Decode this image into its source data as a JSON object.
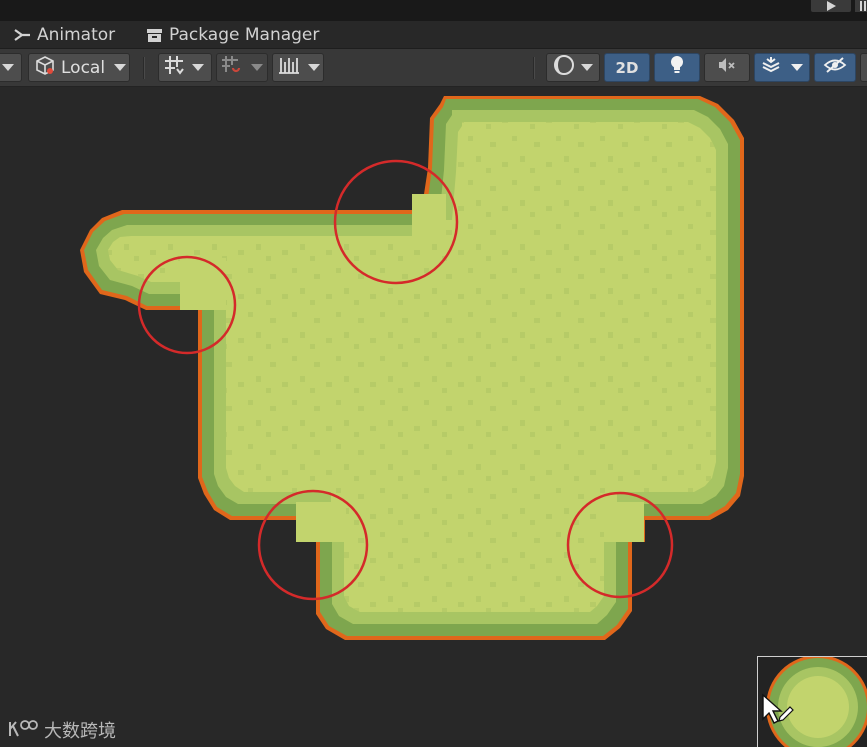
{
  "window": {
    "tabs": [
      {
        "label": "Animator",
        "icon": "animator-icon"
      },
      {
        "label": "Package Manager",
        "icon": "package-icon"
      }
    ]
  },
  "toolbar": {
    "pivot_space": {
      "label": "Local",
      "icon": "cube-icon"
    },
    "toggle_2d": {
      "label": "2D",
      "active": true
    },
    "buttons": [
      "shading-mode-dropdown",
      "lighting-toggle",
      "audio-toggle",
      "effects-dropdown",
      "scene-visibility-toggle"
    ]
  },
  "scene": {
    "tile_colors": {
      "fill": "#c2d46d",
      "mid": "#a8c563",
      "edge": "#7ea64e",
      "outline": "#e0671b"
    },
    "highlight_color": "#d42a2a"
  },
  "watermark": {
    "text": "大数跨境"
  },
  "colors": {
    "accent_blue": "#3d5f86",
    "toolbar_bg": "#383838",
    "scene_bg": "#282828"
  }
}
